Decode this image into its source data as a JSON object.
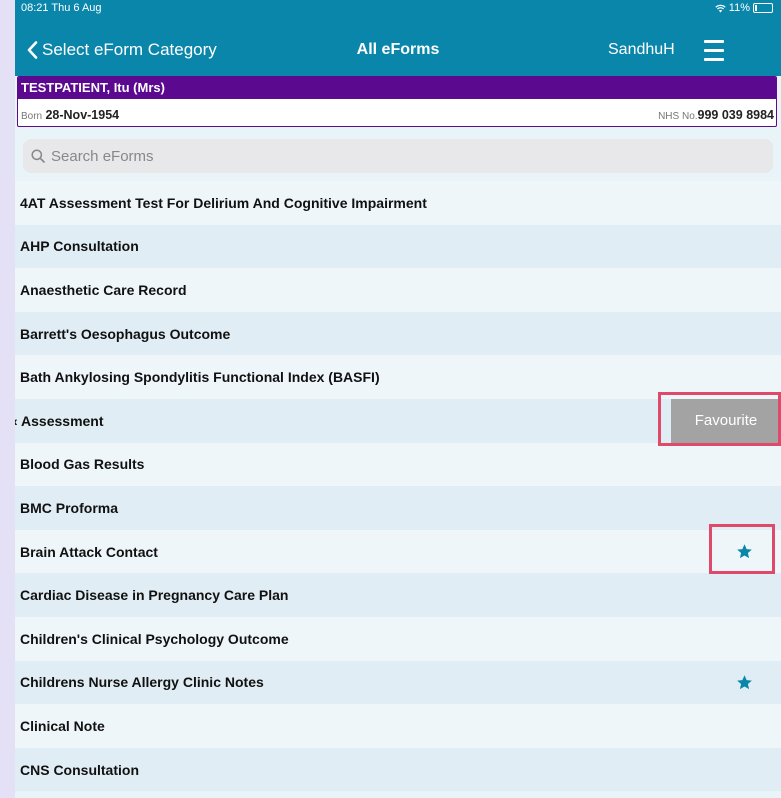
{
  "status_bar": {
    "time": "08:21  Thu 6 Aug",
    "battery": "11%"
  },
  "nav": {
    "back_label": "Select eForm Category",
    "title": "All eForms",
    "user": "SandhuH"
  },
  "patient": {
    "name": "TESTPATIENT, Itu (Mrs)",
    "born_label": "Born",
    "born_value": "28-Nov-1954",
    "nhs_label": "NHS No.",
    "nhs_value": "999 039 8984"
  },
  "search": {
    "placeholder": "Search eForms"
  },
  "forms": [
    {
      "label": "4AT Assessment Test For Delirium And Cognitive Impairment",
      "favourite": false
    },
    {
      "label": "AHP Consultation",
      "favourite": false
    },
    {
      "label": "Anaesthetic Care Record",
      "favourite": false
    },
    {
      "label": "Barrett's Oesophagus Outcome",
      "favourite": false
    },
    {
      "label": "Bath Ankylosing Spondylitis Functional Index (BASFI)",
      "favourite": false
    },
    {
      "label": "‹ Assessment",
      "favourite": false,
      "swipe_action": "Favourite"
    },
    {
      "label": "Blood Gas Results",
      "favourite": false
    },
    {
      "label": "BMC Proforma",
      "favourite": false
    },
    {
      "label": "Brain Attack Contact",
      "favourite": true
    },
    {
      "label": "Cardiac Disease in Pregnancy Care Plan",
      "favourite": false
    },
    {
      "label": "Children's Clinical Psychology Outcome",
      "favourite": false
    },
    {
      "label": "Childrens Nurse Allergy Clinic Notes",
      "favourite": true
    },
    {
      "label": "Clinical Note",
      "favourite": false
    },
    {
      "label": "CNS Consultation",
      "favourite": false
    }
  ],
  "colors": {
    "header": "#0a86ab",
    "patient_banner": "#5b0a8f",
    "star": "#0a86ab",
    "favourite_action": "#a3a3a3",
    "highlight": "#e04a6a"
  }
}
